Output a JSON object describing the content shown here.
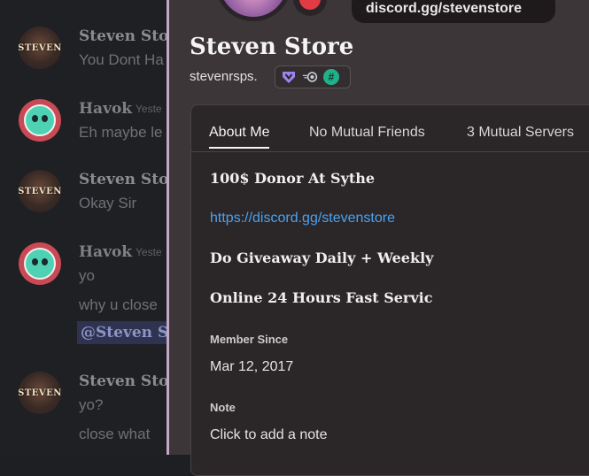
{
  "chat": {
    "messages": [
      {
        "author": "Steven Store",
        "avatar": "steven",
        "timestamp": "",
        "lines": [
          "You Dont Ha"
        ]
      },
      {
        "author": "Havok",
        "avatar": "havok",
        "timestamp": "Yeste",
        "lines": [
          "Eh maybe le"
        ]
      },
      {
        "author": "Steven Store",
        "avatar": "steven",
        "timestamp": "",
        "lines": [
          "Okay Sir"
        ]
      },
      {
        "author": "Havok",
        "avatar": "havok",
        "timestamp": "Yeste",
        "lines": [
          "yo",
          "why u close"
        ],
        "mention": "@Steven S"
      },
      {
        "author": "Steven Store",
        "avatar": "steven",
        "timestamp": "",
        "lines": [
          "yo?",
          "close what"
        ]
      }
    ],
    "avatar_text": "STEVEN"
  },
  "profile": {
    "status_bubble": "discord.gg/stevenstore",
    "display_name": "Steven Store",
    "username": "stevenrsps.",
    "badges": [
      "hypesquad-icon",
      "nitro-icon",
      "hash-icon"
    ],
    "badge_hash_glyph": "#",
    "tabs": [
      {
        "label": "About Me",
        "active": true
      },
      {
        "label": "No Mutual Friends",
        "active": false
      },
      {
        "label": "3 Mutual Servers",
        "active": false
      }
    ],
    "bio": {
      "line1": "100$ Donor At Sythe",
      "link": "https://discord.gg/stevenstore",
      "line3": "Do Giveaway Daily + Weekly",
      "line4": "Online 24 Hours Fast Servic"
    },
    "member_since_label": "Member Since",
    "member_since_value": "Mar 12, 2017",
    "note_label": "Note",
    "note_placeholder": "Click to add a note"
  },
  "colors": {
    "accent_border": "#c4a7c4",
    "status_dnd": "#e23b45",
    "link": "#4aa3f0"
  }
}
